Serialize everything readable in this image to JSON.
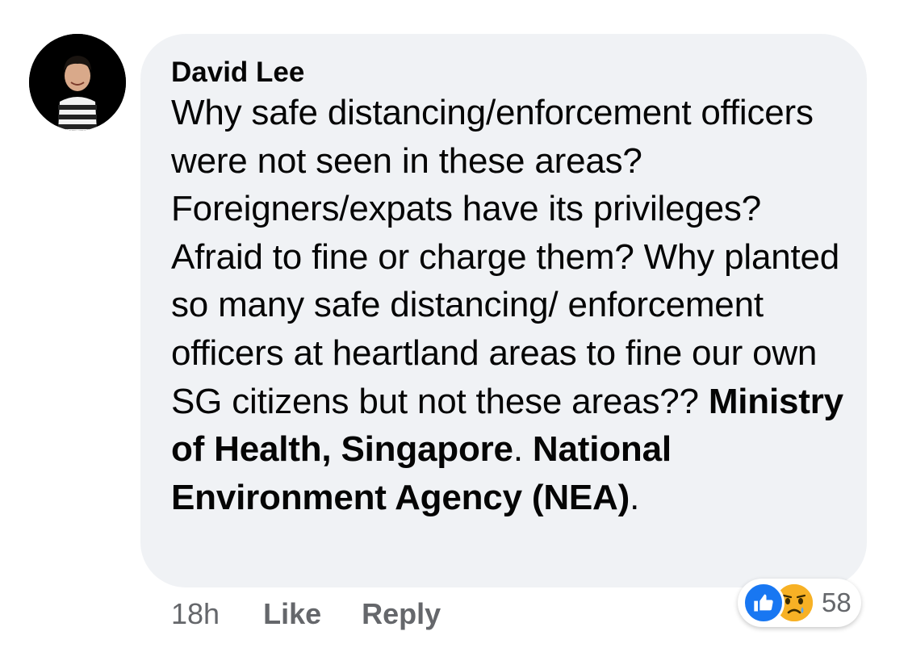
{
  "comment": {
    "author": "David Lee",
    "text": "Why safe distancing/enforcement officers were not seen in these areas? Foreigners/expats have its privileges? Afraid to fine or charge them? Why planted so  many safe distancing/ enforcement officers at heartland areas to fine our own SG citizens but not these areas??  ",
    "mentions": [
      {
        "name": "Ministry of Health, Singapore"
      },
      {
        "name": "National Environment Agency (NEA)"
      }
    ],
    "separator_after_mention_1": ".   ",
    "trailing_punctuation": "."
  },
  "actions": {
    "timestamp": "18h",
    "like_label": "Like",
    "reply_label": "Reply"
  },
  "reactions": {
    "icons": [
      "like-icon",
      "sad-icon"
    ],
    "count": "58",
    "colors": {
      "like": "#1877f2",
      "sad": "#f7b125"
    }
  },
  "colors": {
    "bubble": "#f0f2f5",
    "text": "#050505",
    "secondary": "#65676b"
  }
}
